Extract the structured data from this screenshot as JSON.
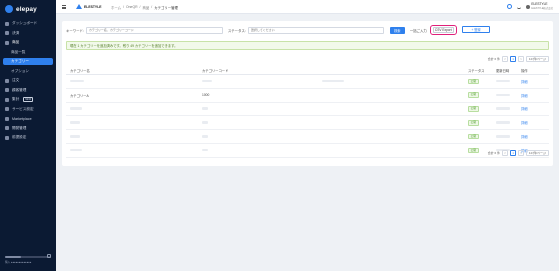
{
  "sidebar": {
    "logo": "elepay",
    "items": [
      {
        "label": "ダッシュボード",
        "icon": "dashboard-icon"
      },
      {
        "label": "決済",
        "icon": "payment-icon"
      },
      {
        "label": "商品",
        "icon": "product-icon"
      },
      {
        "label": "商品一覧",
        "icon": ""
      },
      {
        "label": "カテゴリー",
        "icon": ""
      },
      {
        "label": "オプション",
        "icon": ""
      },
      {
        "label": "注文",
        "icon": "order-icon"
      },
      {
        "label": "顧客管理",
        "icon": "customer-icon"
      },
      {
        "label": "集計",
        "icon": "stats-icon",
        "badge": "NEW"
      },
      {
        "label": "サービス設定",
        "icon": "service-icon"
      },
      {
        "label": "Marketplace",
        "icon": "marketplace-icon"
      },
      {
        "label": "開発管理",
        "icon": "dev-icon"
      },
      {
        "label": "前提設定",
        "icon": "settings-icon"
      }
    ],
    "footer_text": "購入 ●●●●●●●●●●●●●",
    "footer_progress": 0.35
  },
  "header": {
    "store_name": "ELESTYLE",
    "breadcrumb": [
      "ホーム",
      "OneQR",
      "商品",
      "カテゴリー管理"
    ],
    "user_name": "ELESTYLE",
    "user_sub": "ELESTYLE株式会社"
  },
  "filter": {
    "keyword_label": "キーワード:",
    "keyword_placeholder": "カテゴリー名、カテゴリーコード",
    "status_label": "ステータス:",
    "status_placeholder": "選択してください",
    "search_button": "検索",
    "bulk_label": "一括ご入力",
    "csv_button": "CSV Export",
    "add_button": "+ 登録"
  },
  "info_message": "現在 1 カテゴリーを追加済みです。残り 49 カテゴリーを追加できます。",
  "pagination": {
    "total_text": "合計 6 件",
    "prev": "<",
    "current": "1",
    "next": ">",
    "page_size": "10 件/ページ"
  },
  "table": {
    "headers": [
      "カテゴリー名",
      "カテゴリーコード",
      "",
      "ステータス",
      "更新日時",
      "操作"
    ],
    "rows": [
      {
        "name": "",
        "code": "",
        "status": "公開",
        "action": "詳細"
      },
      {
        "name": "カテゴリーA",
        "code": "1000",
        "status": "公開",
        "action": "詳細"
      },
      {
        "name": "",
        "code": "",
        "status": "公開",
        "action": "詳細"
      },
      {
        "name": "",
        "code": "",
        "status": "公開",
        "action": "詳細"
      },
      {
        "name": "",
        "code": "",
        "status": "公開",
        "action": "詳細"
      },
      {
        "name": "",
        "code": "",
        "status": "公開",
        "action": "詳細"
      }
    ]
  },
  "colors": {
    "sidebar_bg": "#0b1a33",
    "accent": "#2f80ed",
    "csv_highlight": "#e0207a",
    "info_bg": "#f2f9ea"
  }
}
